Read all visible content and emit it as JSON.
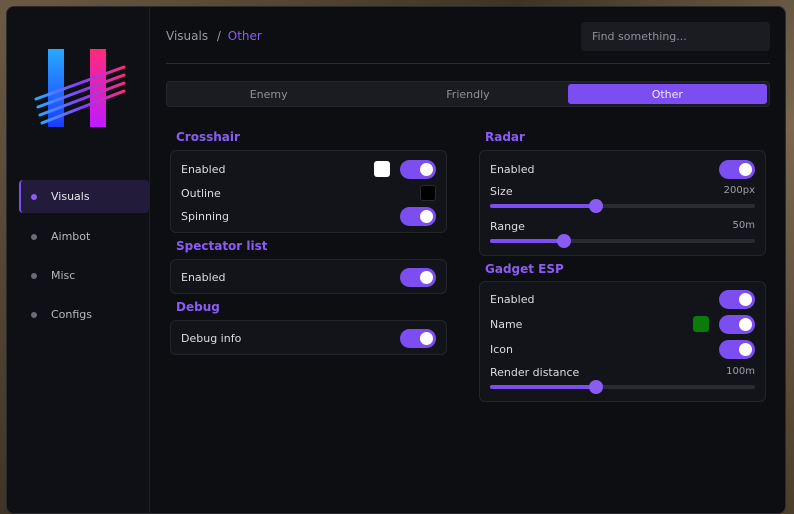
{
  "sidebar": {
    "items": [
      {
        "label": "Visuals",
        "active": true
      },
      {
        "label": "Aimbot",
        "active": false
      },
      {
        "label": "Misc",
        "active": false
      },
      {
        "label": "Configs",
        "active": false
      }
    ]
  },
  "header": {
    "breadcrumb_parent": "Visuals",
    "breadcrumb_sep": "/",
    "breadcrumb_current": "Other",
    "search_placeholder": "Find something..."
  },
  "tabs": [
    {
      "label": "Enemy",
      "active": false
    },
    {
      "label": "Friendly",
      "active": false
    },
    {
      "label": "Other",
      "active": true
    }
  ],
  "crosshair": {
    "title": "Crosshair",
    "enabled_label": "Enabled",
    "enabled": true,
    "color": "#ffffff",
    "outline_label": "Outline",
    "outline_color": "#000000",
    "spinning_label": "Spinning",
    "spinning": true
  },
  "spectator": {
    "title": "Spectator list",
    "enabled_label": "Enabled",
    "enabled": true
  },
  "debug": {
    "title": "Debug",
    "info_label": "Debug info",
    "info": true
  },
  "radar": {
    "title": "Radar",
    "enabled_label": "Enabled",
    "enabled": true,
    "size_label": "Size",
    "size_value": "200px",
    "size_fraction": 0.4,
    "range_label": "Range",
    "range_value": "50m",
    "range_fraction": 0.28
  },
  "gadget": {
    "title": "Gadget ESP",
    "enabled_label": "Enabled",
    "enabled": true,
    "name_label": "Name",
    "name": true,
    "name_color": "#0a7a0a",
    "icon_label": "Icon",
    "icon": true,
    "distance_label": "Render distance",
    "distance_value": "100m",
    "distance_fraction": 0.4
  },
  "colors": {
    "accent": "#7c4df0",
    "accent_text": "#8a5cf5",
    "panel": "#0d0e12"
  }
}
